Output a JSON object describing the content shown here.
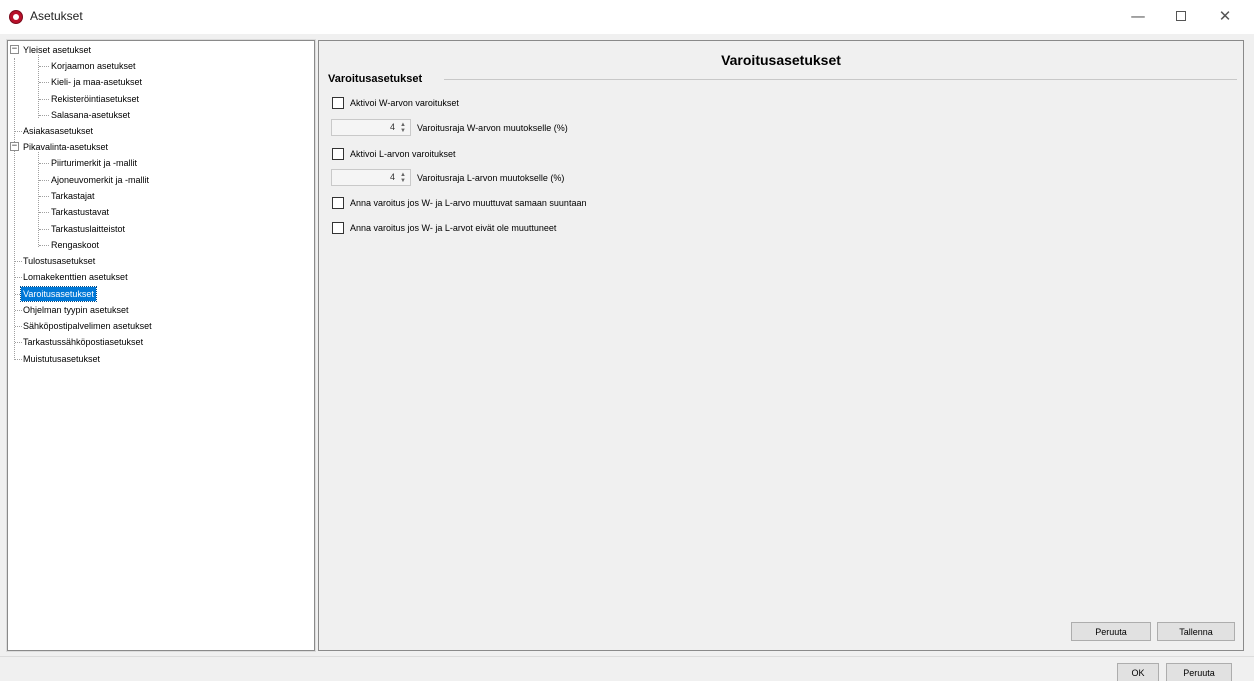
{
  "window": {
    "title": "Asetukset",
    "minimize_glyph": "—",
    "close_glyph": "✕"
  },
  "tree": {
    "expander_collapse_glyph": "−",
    "items": [
      {
        "label": "Yleiset asetukset"
      },
      {
        "label": "Korjaamon asetukset"
      },
      {
        "label": "Kieli- ja maa-asetukset"
      },
      {
        "label": "Rekisteröintiasetukset"
      },
      {
        "label": "Salasana-asetukset"
      },
      {
        "label": "Asiakasasetukset"
      },
      {
        "label": "Pikavalinta-asetukset"
      },
      {
        "label": "Piirturimerkit ja -mallit"
      },
      {
        "label": "Ajoneuvomerkit ja -mallit"
      },
      {
        "label": "Tarkastajat"
      },
      {
        "label": "Tarkastustavat"
      },
      {
        "label": "Tarkastuslaitteistot"
      },
      {
        "label": "Rengaskoot"
      },
      {
        "label": "Tulostusasetukset"
      },
      {
        "label": "Lomakekenttien asetukset"
      },
      {
        "label": "Varoitusasetukset"
      },
      {
        "label": "Ohjelman tyypin asetukset"
      },
      {
        "label": "Sähköpostipalvelimen asetukset"
      },
      {
        "label": "Tarkastussähköpostiasetukset"
      },
      {
        "label": "Muistutusasetukset"
      }
    ],
    "selected_label": "Varoitusasetukset"
  },
  "content": {
    "title": "Varoitusasetukset",
    "group_title": "Varoitusasetukset",
    "w_activate_label": "Aktivoi W-arvon varoitukset",
    "w_threshold_value": "4",
    "w_threshold_label": "Varoitusraja W-arvon muutokselle (%)",
    "l_activate_label": "Aktivoi L-arvon varoitukset",
    "l_threshold_value": "4",
    "l_threshold_label": "Varoitusraja L-arvon muutokselle (%)",
    "same_direction_label": "Anna varoitus jos W- ja L-arvo muuttuvat samaan suuntaan",
    "unchanged_label": "Anna varoitus jos W- ja L-arvot eivät ole muuttuneet",
    "spin_up_glyph": "▲",
    "spin_down_glyph": "▼",
    "cancel_label": "Peruuta",
    "save_label": "Tallenna"
  },
  "footer": {
    "ok_label": "OK",
    "cancel_label": "Peruuta"
  },
  "colors": {
    "selection": "#0078d7",
    "app_icon": "#b8102a"
  }
}
